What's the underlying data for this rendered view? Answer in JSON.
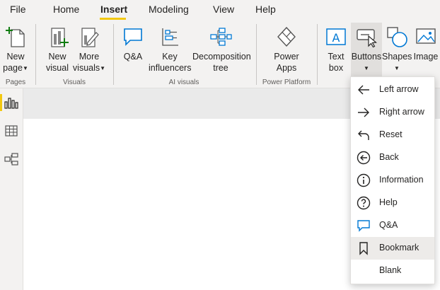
{
  "menu": {
    "tabs": [
      "File",
      "Home",
      "Insert",
      "Modeling",
      "View",
      "Help"
    ],
    "active": "Insert"
  },
  "ribbon": {
    "pages_group": {
      "label": "Pages",
      "new_page": [
        "New",
        "page"
      ]
    },
    "visuals_group": {
      "label": "Visuals",
      "new_visual": [
        "New",
        "visual"
      ],
      "more_visuals": [
        "More",
        "visuals"
      ]
    },
    "ai_group": {
      "label": "AI visuals",
      "qa": "Q&A",
      "key_influencers": [
        "Key",
        "influencers"
      ],
      "decomposition_tree": [
        "Decomposition",
        "tree"
      ]
    },
    "power_platform_group": {
      "label": "Power Platform",
      "power_apps": [
        "Power",
        "Apps"
      ]
    },
    "elements": {
      "text_box": [
        "Text",
        "box"
      ],
      "buttons": "Buttons",
      "shapes": "Shapes",
      "image": "Image"
    }
  },
  "buttons_menu": {
    "items": [
      {
        "label": "Left arrow",
        "icon": "left-arrow-icon"
      },
      {
        "label": "Right arrow",
        "icon": "right-arrow-icon"
      },
      {
        "label": "Reset",
        "icon": "reset-icon"
      },
      {
        "label": "Back",
        "icon": "back-icon"
      },
      {
        "label": "Information",
        "icon": "info-icon"
      },
      {
        "label": "Help",
        "icon": "help-icon"
      },
      {
        "label": "Q&A",
        "icon": "qa-icon"
      },
      {
        "label": "Bookmark",
        "icon": "bookmark-icon"
      },
      {
        "label": "Blank",
        "icon": ""
      }
    ],
    "hovered": "Bookmark"
  },
  "colors": {
    "accent": "#f2c811",
    "icon_blue": "#0078d4",
    "icon_green": "#107c10"
  }
}
